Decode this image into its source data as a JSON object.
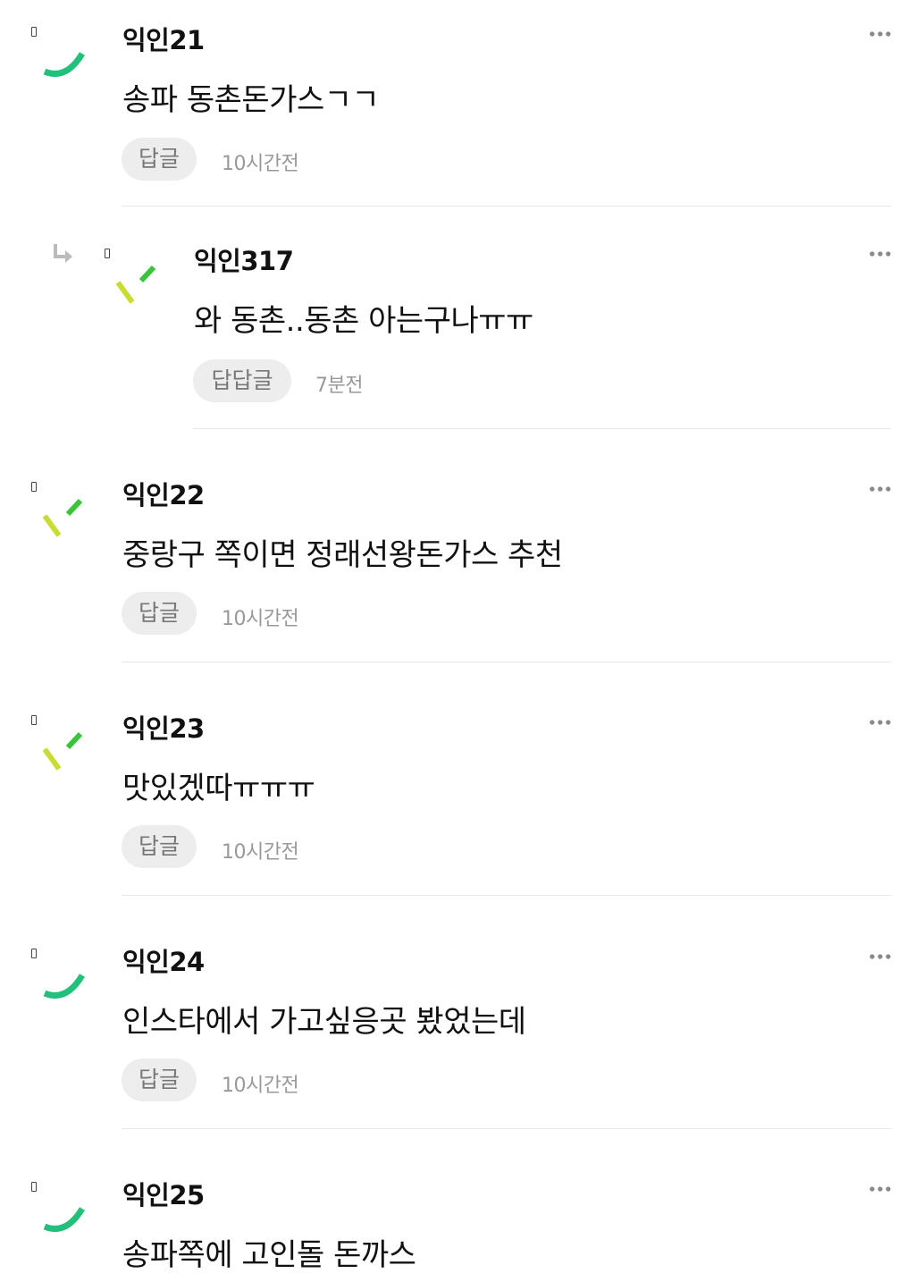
{
  "comments": [
    {
      "user": "익인21",
      "text": "송파 동촌돈가스ㄱㄱ",
      "reply_label": "답글",
      "time": "10시간전",
      "avatar": "green-arc"
    },
    {
      "user": "익인317",
      "text": "와 동촌..동촌 아는구나ㅠㅠ",
      "reply_label": "답답글",
      "time": "7분전",
      "avatar": "lime-dashes",
      "is_reply": true
    },
    {
      "user": "익인22",
      "text": "중랑구 쪽이면 정래선왕돈가스 추천",
      "reply_label": "답글",
      "time": "10시간전",
      "avatar": "lime-dashes"
    },
    {
      "user": "익인23",
      "text": "맛있겠따ㅠㅠㅠ",
      "reply_label": "답글",
      "time": "10시간전",
      "avatar": "lime-dashes"
    },
    {
      "user": "익인24",
      "text": "인스타에서 가고싶응곳 봤었는데",
      "reply_label": "답글",
      "time": "10시간전",
      "avatar": "green-arc"
    },
    {
      "user": "익인25",
      "text": "송파쪽에 고인돌 돈까스",
      "avatar": "green-arc"
    }
  ],
  "icons": {
    "more": "more-dots-icon",
    "reply_arrow": "reply-arrow-icon"
  },
  "colors": {
    "arc_green": "#22c07a",
    "dash_lime": "#c8dc32",
    "dash_green": "#3ac43a",
    "button_bg": "#ededed",
    "time_gray": "#999999",
    "divider": "#e6e6e6"
  }
}
